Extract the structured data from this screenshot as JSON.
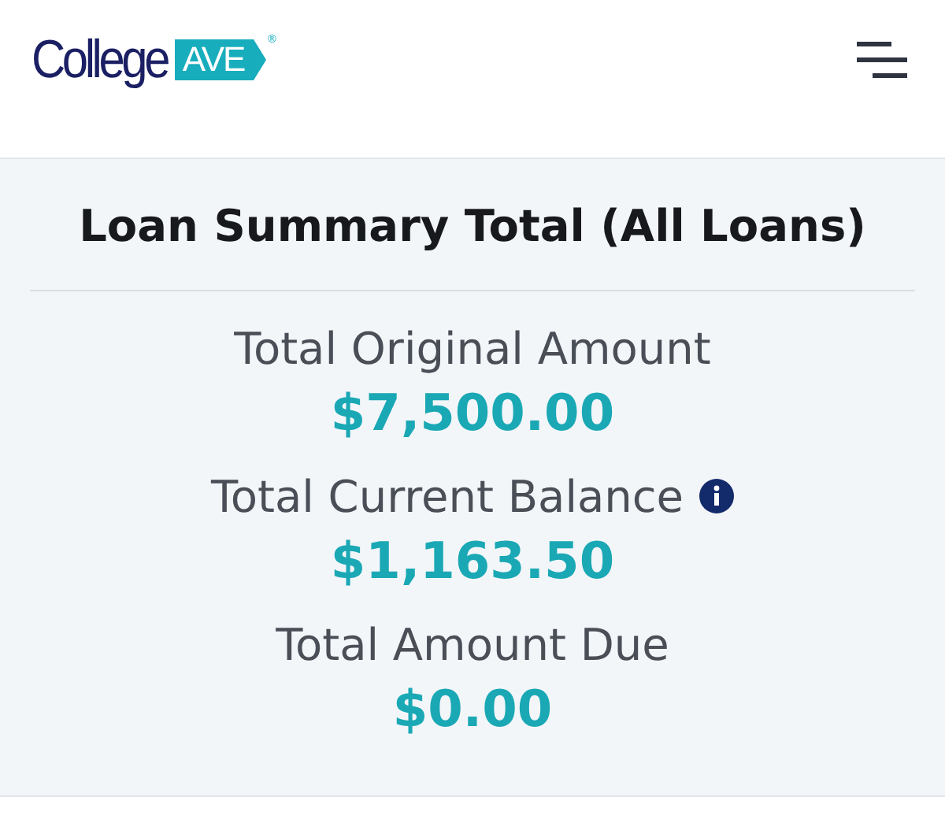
{
  "header": {
    "logo": {
      "word": "College",
      "tag": "AVE",
      "mark": "®"
    }
  },
  "summary": {
    "title": "Loan Summary Total (All Loans)",
    "items": [
      {
        "label": "Total Original Amount",
        "value": "$7,500.00",
        "info": false
      },
      {
        "label": "Total Current Balance",
        "value": "$1,163.50",
        "info": true
      },
      {
        "label": "Total Amount Due",
        "value": "$0.00",
        "info": false
      }
    ]
  }
}
